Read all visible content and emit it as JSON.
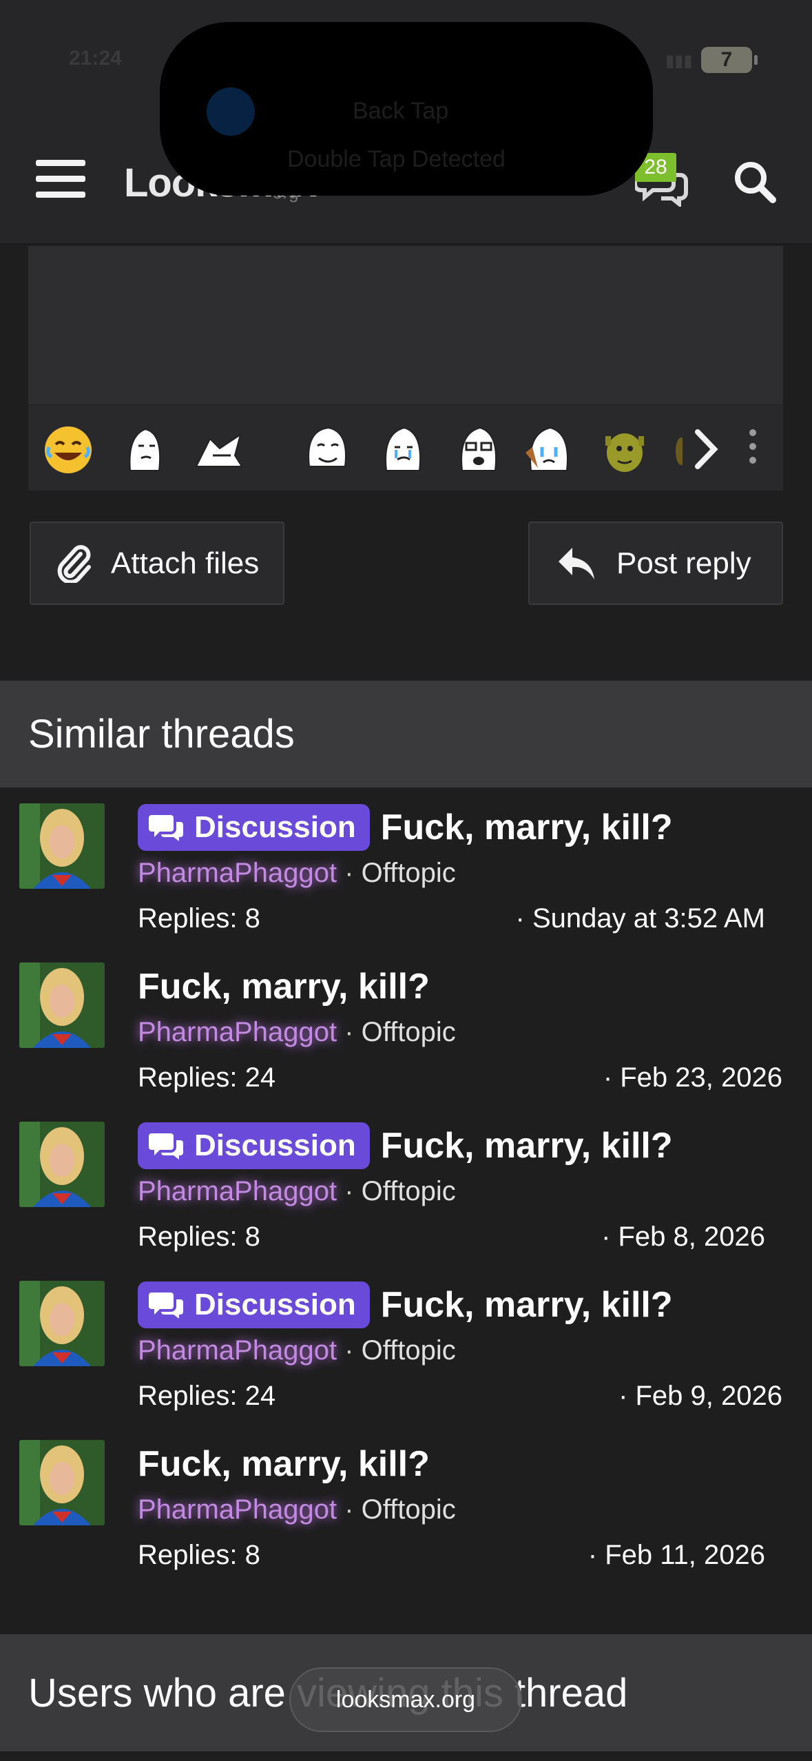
{
  "status_bar": {
    "time": "21:24",
    "battery": "7"
  },
  "notification": {
    "title": "Back Tap",
    "subtitle": "Double Tap Detected"
  },
  "header": {
    "logo": "Looksmax",
    "logo_sub": "org",
    "chat_badge": "28"
  },
  "emoji_bar": {
    "items": [
      "laughing-emoji",
      "wojak-emoji",
      "chad-shark-emoji",
      "trollface-emoji",
      "crying-wojak-emoji",
      "soyjak-glasses-emoji",
      "crying-bald-emoji",
      "shrek-emoji",
      "partial-emoji"
    ]
  },
  "actions": {
    "attach": "Attach files",
    "reply": "Post reply"
  },
  "similar": {
    "title": "Similar threads",
    "threads": [
      {
        "label": "Discussion",
        "title": "Fuck, marry, kill?",
        "user": "PharmaPhaggot",
        "forum": "Offtopic",
        "replies": "Replies: 8",
        "date": "· Sunday at 3:52 AM"
      },
      {
        "label": "",
        "title": "Fuck, marry, kill?",
        "user": "PharmaPhaggot",
        "forum": "Offtopic",
        "replies": "Replies: 24",
        "date": "· Feb 23, 2026"
      },
      {
        "label": "Discussion",
        "title": "Fuck, marry, kill?",
        "user": "PharmaPhaggot",
        "forum": "Offtopic",
        "replies": "Replies: 8",
        "date": "· Feb 8, 2026"
      },
      {
        "label": "Discussion",
        "title": "Fuck, marry, kill?",
        "user": "PharmaPhaggot",
        "forum": "Offtopic",
        "replies": "Replies: 24",
        "date": "· Feb 9, 2026"
      },
      {
        "label": "",
        "title": "Fuck, marry, kill?",
        "user": "PharmaPhaggot",
        "forum": "Offtopic",
        "replies": "Replies: 8",
        "date": "· Feb 11, 2026"
      }
    ]
  },
  "viewing": {
    "title": "Users who are viewing this thread"
  },
  "browser": {
    "url": "looksmax.org"
  },
  "colors": {
    "background": "#1e1e1f",
    "header": "#262628",
    "section": "#3a3a3c",
    "label": "#6a4ad8",
    "username": "#c28ae0",
    "badge": "#7dbf2c"
  }
}
